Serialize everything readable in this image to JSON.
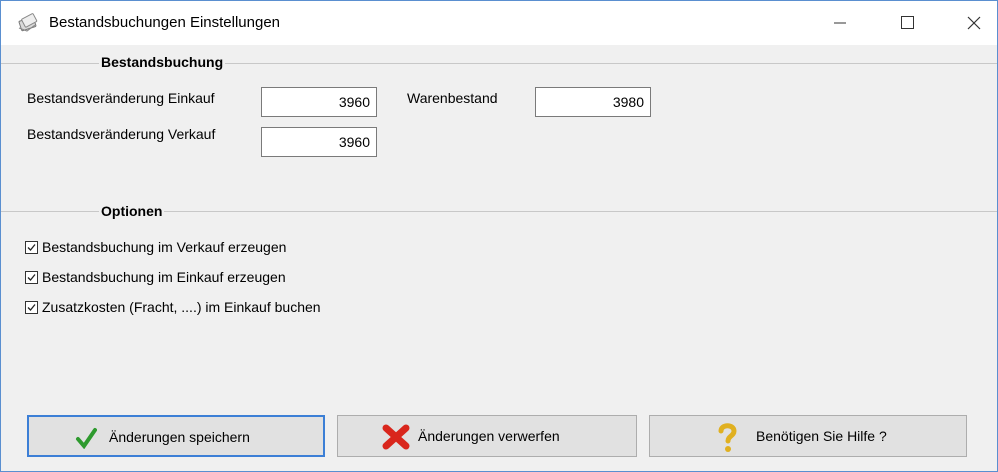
{
  "window": {
    "title": "Bestandsbuchungen Einstellungen"
  },
  "bestandsbuchung": {
    "group_title": "Bestandsbuchung",
    "einkauf_label": "Bestandsveränderung Einkauf",
    "einkauf_value": "3960",
    "verkauf_label": "Bestandsveränderung Verkauf",
    "verkauf_value": "3960",
    "warenbestand_label": "Warenbestand",
    "warenbestand_value": "3980"
  },
  "optionen": {
    "group_title": "Optionen",
    "items": [
      {
        "label": "Bestandsbuchung im Verkauf erzeugen",
        "checked": true
      },
      {
        "label": "Bestandsbuchung im Einkauf erzeugen",
        "checked": true
      },
      {
        "label": "Zusatzkosten (Fracht, ....) im Einkauf buchen",
        "checked": true
      }
    ]
  },
  "buttons": {
    "save_label": "Änderungen speichern",
    "discard_label": "Änderungen verwerfen",
    "help_label": "Benötigen Sie Hilfe ?"
  },
  "colors": {
    "accent": "#3c7fd6",
    "check_green": "#2e9a2e",
    "cross_red": "#d9261c",
    "help_yellow": "#e0b020"
  }
}
